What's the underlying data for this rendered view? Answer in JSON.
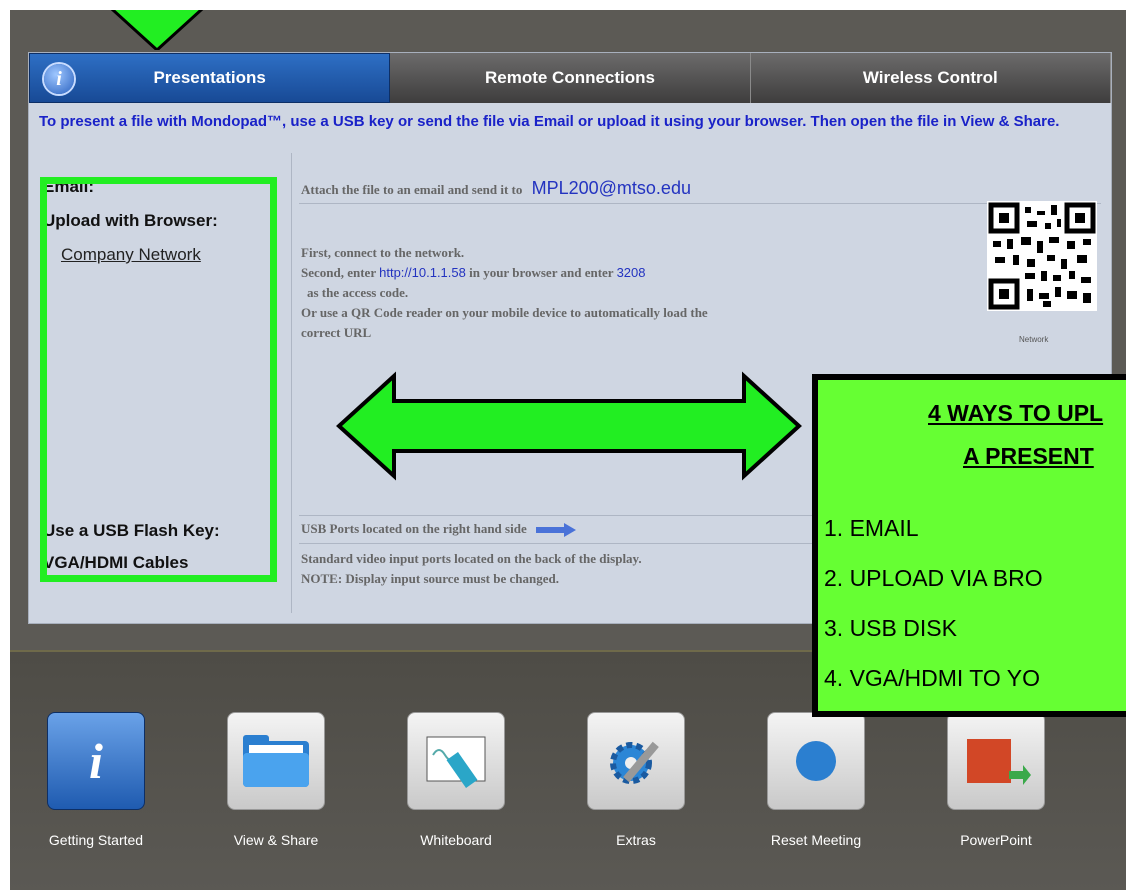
{
  "tabs": [
    {
      "label": "Presentations",
      "active": true,
      "icon": "info-icon"
    },
    {
      "label": "Remote Connections",
      "active": false
    },
    {
      "label": "Wireless Control",
      "active": false
    }
  ],
  "intro": "To present a file with Mondopad™, use a USB key or send the file via Email or upload it using your browser.  Then open the file in View & Share.",
  "rows": {
    "email": {
      "label": "Email:",
      "desc": "Attach the file to an email and send it to",
      "address": "MPL200@mtso.edu"
    },
    "upload": {
      "label": "Upload with Browser:",
      "network": "Company Network",
      "line1": "First, connect to the network.",
      "line2_pre": "Second, enter",
      "url": "http://10.1.1.58",
      "line2_mid": "in your browser and enter",
      "code": "3208",
      "line3": "as the access code.",
      "line4": "Or use a QR Code reader on your mobile device to automatically load the",
      "line5": "correct URL",
      "qr_label": "Network"
    },
    "usb": {
      "label": "Use a USB Flash Key:",
      "desc": "USB Ports located on the right hand side"
    },
    "vga": {
      "label": "VGA/HDMI Cables",
      "desc1": "Standard video input ports located on the back of the display.",
      "desc2": "NOTE: Display input source must be changed."
    }
  },
  "callout": {
    "title1": "4 WAYS TO UPL",
    "title2": "A PRESENT",
    "items": [
      "1.  EMAIL",
      "2.  UPLOAD VIA BRO",
      "3.  USB DISK",
      "4.  VGA/HDMI TO YO"
    ]
  },
  "dock": [
    {
      "label": "Getting Started",
      "icon": "info-book-icon"
    },
    {
      "label": "View & Share",
      "icon": "folder-icon"
    },
    {
      "label": "Whiteboard",
      "icon": "marker-icon"
    },
    {
      "label": "Extras",
      "icon": "gear-wrench-icon"
    },
    {
      "label": "Reset Meeting",
      "icon": "reset-icon"
    },
    {
      "label": "PowerPoint",
      "icon": "powerpoint-icon"
    }
  ],
  "colors": {
    "highlight": "#22ee22",
    "callout": "#66ff33",
    "tab_active": "#1f5bb0",
    "link_blue": "#2333c0"
  }
}
